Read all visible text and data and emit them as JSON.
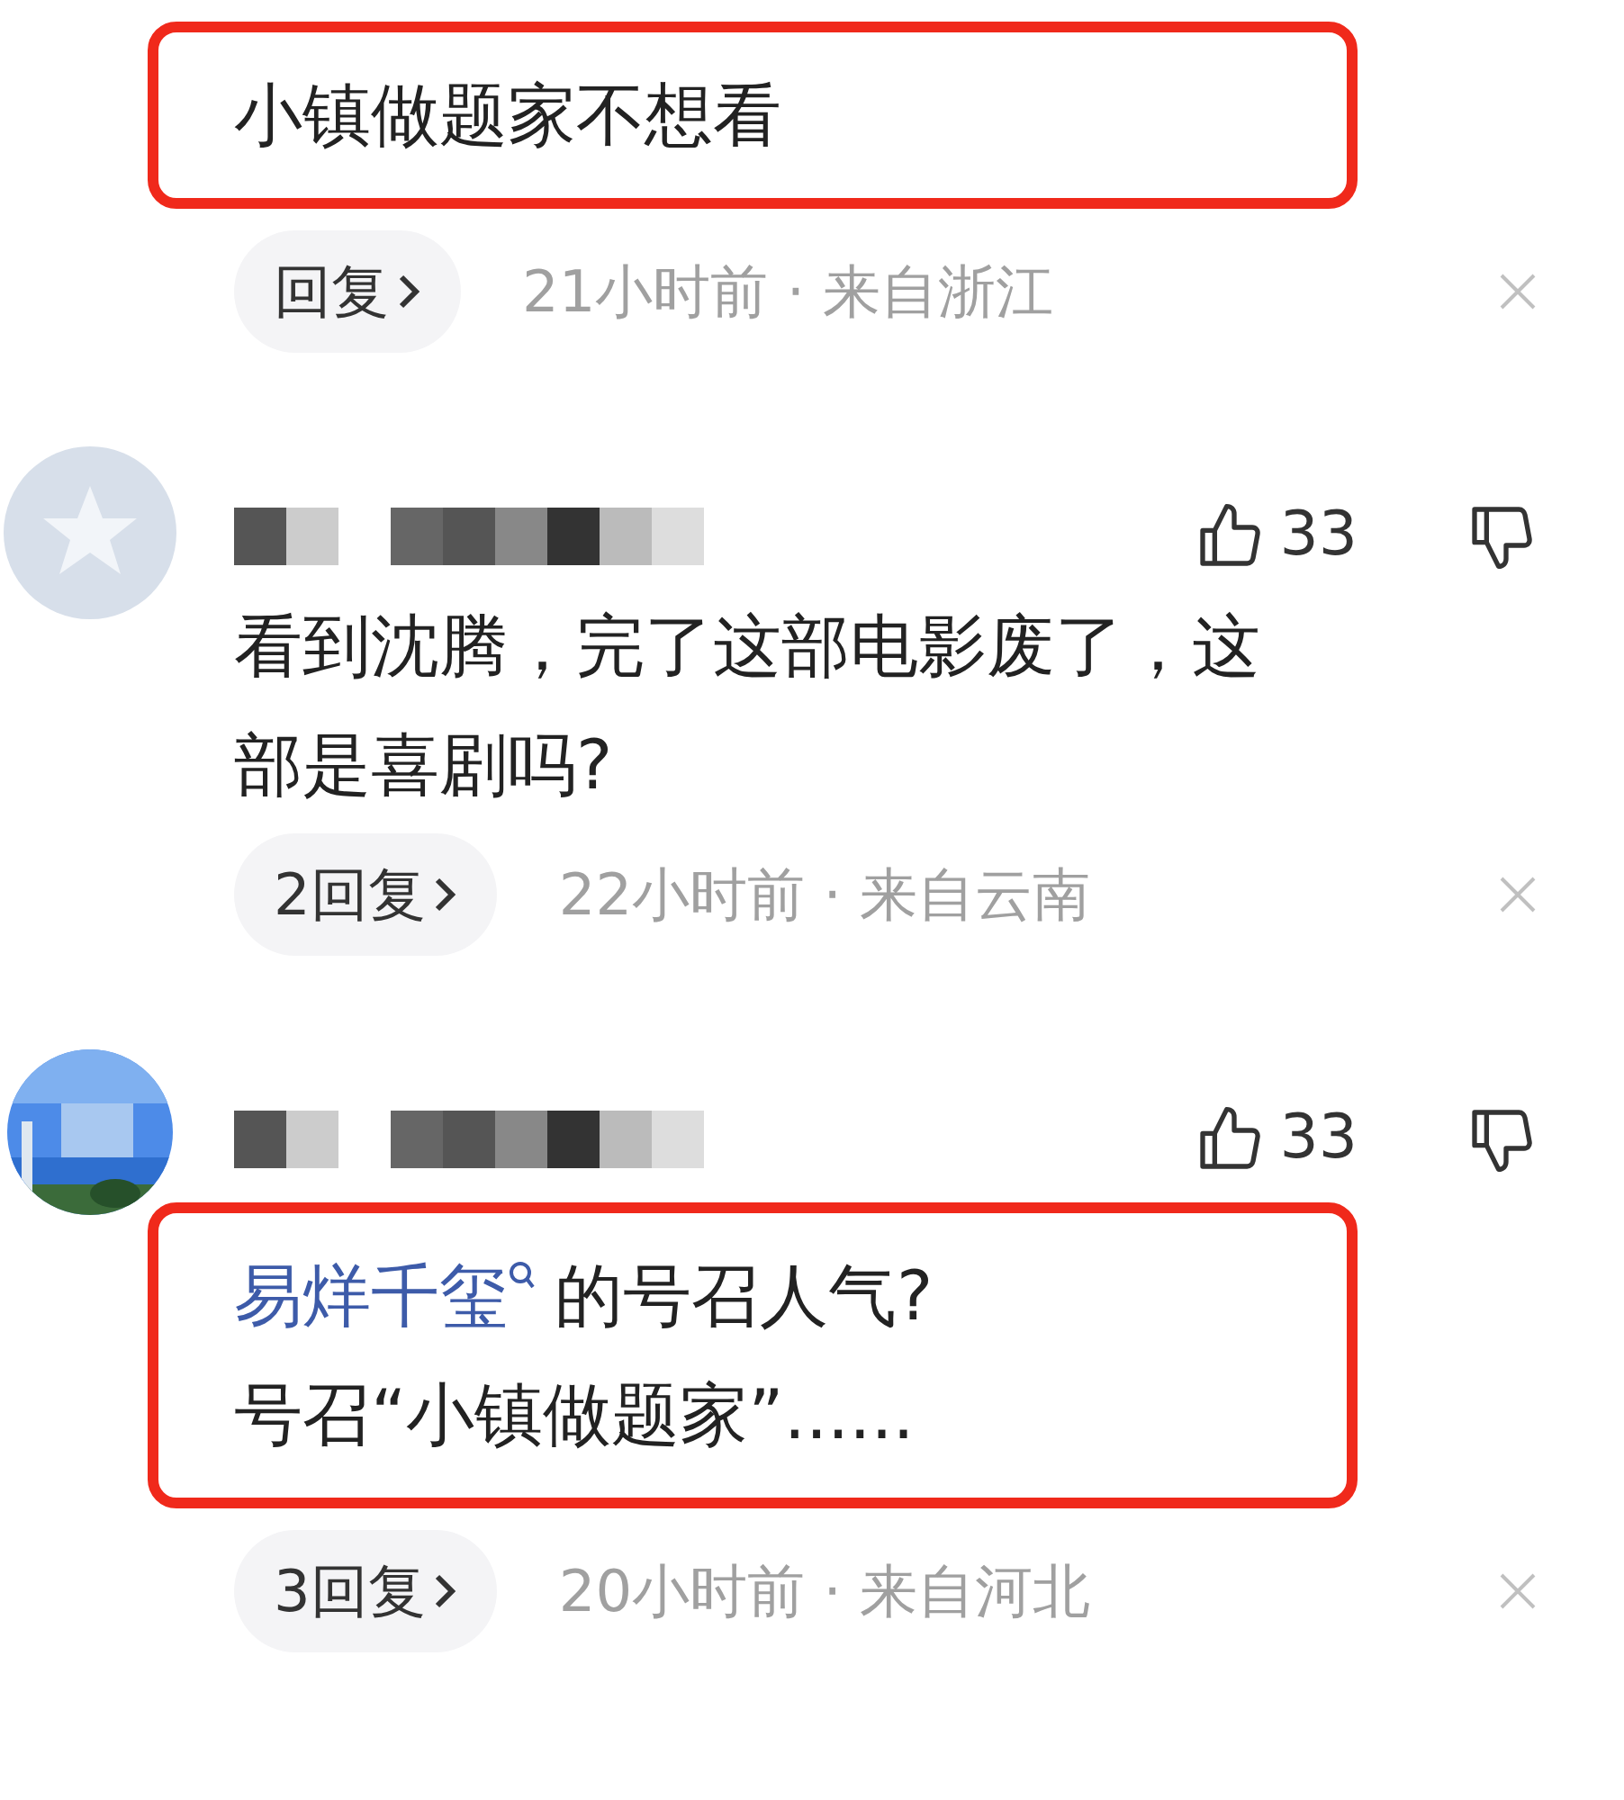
{
  "comments": [
    {
      "kind": "continued",
      "highlighted": true,
      "lines": [
        [
          {
            "kind": "text",
            "text": "小镇做题家不想看"
          }
        ]
      ],
      "reply": "回复",
      "time": "21小时前 · 来自浙江"
    },
    {
      "kind": "full",
      "avatar": {
        "kind": "icon"
      },
      "likes": "33",
      "highlighted": false,
      "lines": [
        [
          {
            "kind": "text",
            "text": "看到沈腾，完了这部电影废了，这"
          }
        ],
        [
          {
            "kind": "text",
            "text": "部是喜剧吗?"
          }
        ]
      ],
      "reply": "2回复",
      "time": "22小时前 · 来自云南"
    },
    {
      "kind": "full",
      "avatar": {
        "kind": "picture"
      },
      "likes": "33",
      "highlighted": true,
      "lines": [
        [
          {
            "kind": "link",
            "text": "易烊千玺"
          },
          {
            "kind": "text",
            "text": "的号召人气?"
          }
        ],
        [
          {
            "kind": "text",
            "text": "号召“小镇做题家”......"
          }
        ]
      ],
      "reply": "3回复",
      "time": "20小时前 · 来自河北"
    }
  ]
}
